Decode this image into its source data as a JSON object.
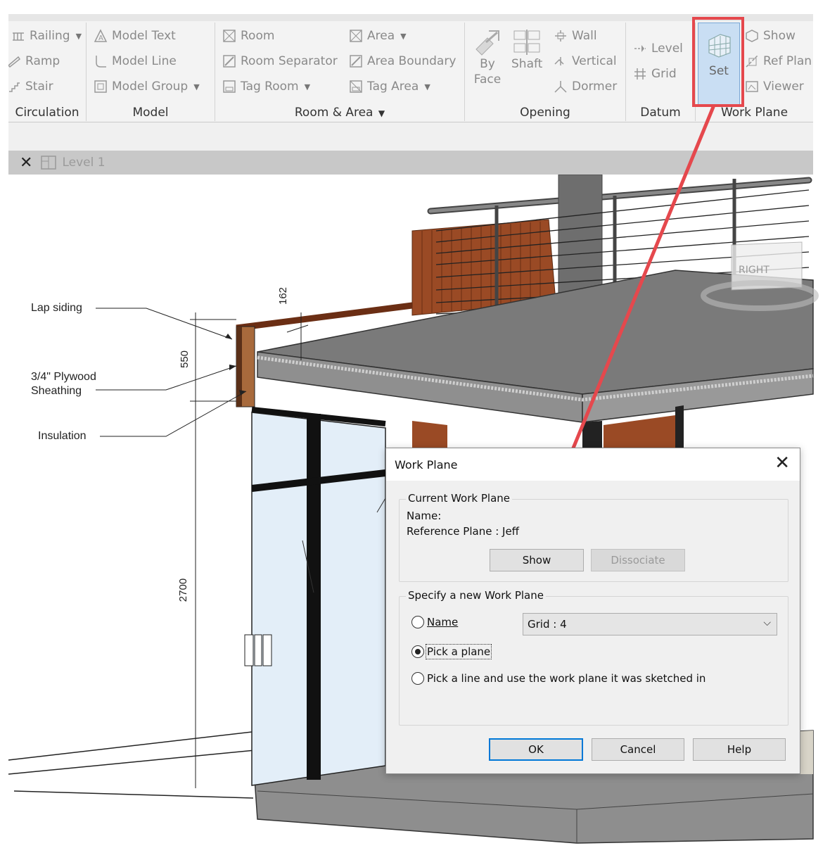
{
  "ribbon": {
    "circulation": {
      "items": [
        "Railing",
        "Ramp",
        "Stair"
      ],
      "title": "Circulation"
    },
    "model": {
      "items": [
        "Model Text",
        "Model Line",
        "Model Group"
      ],
      "title": "Model"
    },
    "room_area": {
      "items_left": [
        "Room",
        "Room Separator",
        "Tag Room"
      ],
      "items_right": [
        "Area",
        "Area Boundary",
        "Tag Area"
      ],
      "title": "Room & Area"
    },
    "opening": {
      "by_face_1": "By",
      "by_face_2": "Face",
      "shaft": "Shaft",
      "items": [
        "Wall",
        "Vertical",
        "Dormer"
      ],
      "title": "Opening"
    },
    "datum": {
      "items": [
        "Level",
        "Grid"
      ],
      "title": "Datum"
    },
    "work_plane": {
      "set": "Set",
      "items": [
        "Show",
        "Ref Plan",
        "Viewer"
      ],
      "title": "Work Plane"
    }
  },
  "view_tab": {
    "label": "Level 1"
  },
  "drawing": {
    "annotations": [
      "Lap siding",
      "3/4\" Plywood",
      "Sheathing",
      "Insulation"
    ],
    "dimensions": [
      "162",
      "550",
      "2700"
    ],
    "viewcube": "RIGHT"
  },
  "dialog": {
    "title": "Work Plane",
    "current": {
      "legend": "Current Work Plane",
      "name_label": "Name:",
      "name_value": "Reference Plane : Jeff",
      "show_button": "Show",
      "dissociate_button": "Dissociate"
    },
    "specify": {
      "legend": "Specify a new Work Plane",
      "options": [
        "Name",
        "Pick a plane",
        "Pick a line and use the work plane it was sketched in"
      ],
      "selected_option": "Pick a plane",
      "name_select_value": "Grid : 4"
    },
    "buttons": {
      "ok": "OK",
      "cancel": "Cancel",
      "help": "Help"
    }
  },
  "colors": {
    "highlight": "#e5484d",
    "set_button_bg": "#c9def3",
    "dialog_default_border": "#0078d7"
  }
}
